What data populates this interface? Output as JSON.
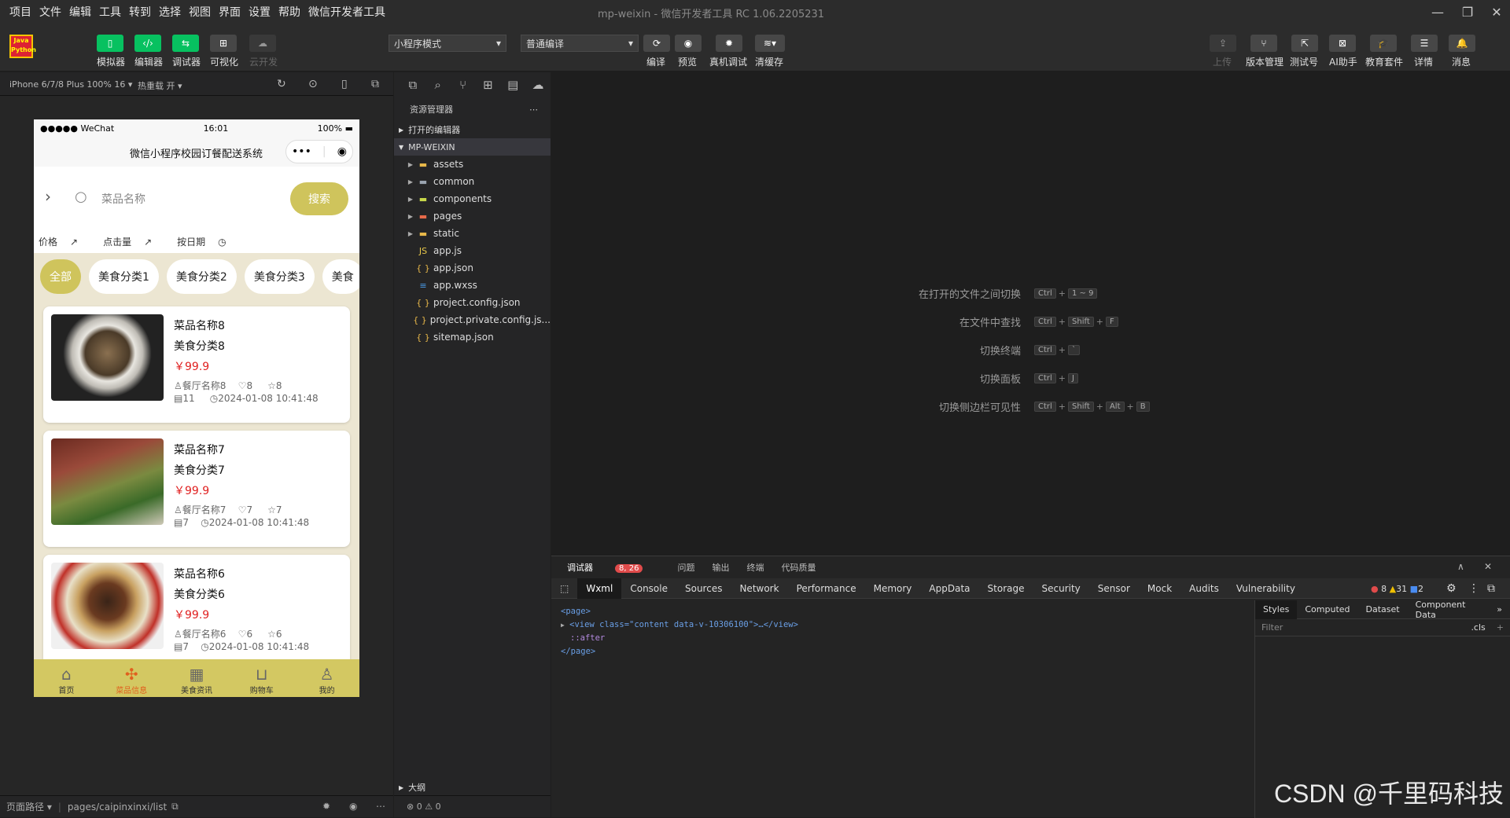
{
  "menu": [
    "项目",
    "文件",
    "编辑",
    "工具",
    "转到",
    "选择",
    "视图",
    "界面",
    "设置",
    "帮助",
    "微信开发者工具"
  ],
  "window_title": "mp-weixin - 微信开发者工具 RC 1.06.2205231",
  "toolbar": {
    "simulator": "模拟器",
    "editor": "编辑器",
    "debugger": "调试器",
    "visual": "可视化",
    "cloud": "云开发",
    "mode": "小程序模式",
    "compile_mode": "普通编译",
    "compile": "编译",
    "preview": "预览",
    "remote_debug": "真机调试",
    "clear_cache": "清缓存",
    "upload": "上传",
    "version": "版本管理",
    "test": "测试号",
    "ai": "AI助手",
    "edu": "教育套件",
    "detail": "详情",
    "message": "消息"
  },
  "simbar": {
    "device": "iPhone 6/7/8 Plus 100% 16",
    "hotreload": "热重载 开"
  },
  "phone": {
    "carrier": "●●●●● WeChat",
    "time": "16:01",
    "battery": "100%",
    "title": "微信小程序校园订餐配送系统",
    "search_placeholder": "菜品名称",
    "search_button": "搜索",
    "sort": [
      "价格",
      "点击量",
      "按日期"
    ],
    "categories": [
      "全部",
      "美食分类1",
      "美食分类2",
      "美食分类3",
      "美食"
    ],
    "items": [
      {
        "name": "菜品名称8",
        "category": "美食分类8",
        "price": "￥99.9",
        "restaurant": "餐厅名称8",
        "likes": "8",
        "favs": "8",
        "views": "11",
        "date": "2024-01-08 10:41:48"
      },
      {
        "name": "菜品名称7",
        "category": "美食分类7",
        "price": "￥99.9",
        "restaurant": "餐厅名称7",
        "likes": "7",
        "favs": "7",
        "views": "7",
        "date": "2024-01-08 10:41:48"
      },
      {
        "name": "菜品名称6",
        "category": "美食分类6",
        "price": "￥99.9",
        "restaurant": "餐厅名称6",
        "likes": "6",
        "favs": "6",
        "views": "7",
        "date": "2024-01-08 10:41:48"
      }
    ],
    "tabs": [
      "首页",
      "菜品信息",
      "美食资讯",
      "购物车",
      "我的"
    ]
  },
  "sim_footer": {
    "path_label": "页面路径",
    "path": "pages/caipinxinxi/list"
  },
  "explorer": {
    "title": "资源管理器",
    "open_editors": "打开的编辑器",
    "project": "MP-WEIXIN",
    "files": [
      {
        "name": "assets",
        "kind": "folder"
      },
      {
        "name": "common",
        "kind": "folder"
      },
      {
        "name": "components",
        "kind": "folder"
      },
      {
        "name": "pages",
        "kind": "folder"
      },
      {
        "name": "static",
        "kind": "folder"
      },
      {
        "name": "app.js",
        "kind": "js"
      },
      {
        "name": "app.json",
        "kind": "json"
      },
      {
        "name": "app.wxss",
        "kind": "css"
      },
      {
        "name": "project.config.json",
        "kind": "json"
      },
      {
        "name": "project.private.config.js...",
        "kind": "json"
      },
      {
        "name": "sitemap.json",
        "kind": "json"
      }
    ],
    "outline": "大纲",
    "status": "⊗ 0 ⚠ 0"
  },
  "shortcuts": [
    {
      "label": "在打开的文件之间切换",
      "keys": [
        "Ctrl",
        "1 ~ 9"
      ]
    },
    {
      "label": "在文件中查找",
      "keys": [
        "Ctrl",
        "Shift",
        "F"
      ]
    },
    {
      "label": "切换终端",
      "keys": [
        "Ctrl",
        "`"
      ]
    },
    {
      "label": "切换面板",
      "keys": [
        "Ctrl",
        "J"
      ]
    },
    {
      "label": "切换侧边栏可见性",
      "keys": [
        "Ctrl",
        "Shift",
        "Alt",
        "B"
      ]
    }
  ],
  "devtools": {
    "top_tabs": [
      "调试器",
      "问题",
      "输出",
      "终端",
      "代码质量"
    ],
    "badge": "8, 26",
    "tabs": [
      "Wxml",
      "Console",
      "Sources",
      "Network",
      "Performance",
      "Memory",
      "AppData",
      "Storage",
      "Security",
      "Sensor",
      "Mock",
      "Audits",
      "Vulnerability"
    ],
    "errors": "8",
    "warnings": "31",
    "infos": "2",
    "code_lines": [
      "<page>",
      "<view class=\"content data-v-10306100\">…</view>",
      "::after",
      "</page>"
    ],
    "style_tabs": [
      "Styles",
      "Computed",
      "Dataset",
      "Component Data"
    ],
    "filter": "Filter",
    "cls": ".cls"
  },
  "watermark": "CSDN @千里码科技",
  "colors": {
    "accent_green": "#07c160",
    "tab_yellow": "#d3c862",
    "price_red": "#e02020",
    "badge_red": "#e04b4b"
  }
}
